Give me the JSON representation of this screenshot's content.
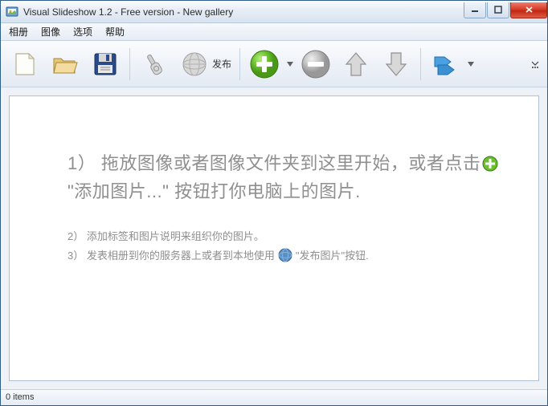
{
  "window": {
    "title": "Visual Slideshow 1.2 - Free version - New gallery"
  },
  "menu": {
    "album": "相册",
    "image": "图像",
    "options": "选项",
    "help": "帮助"
  },
  "toolbar": {
    "publish_label": "发布"
  },
  "content": {
    "step1_a": "1） 拖放图像或者图像文件夹到这里开始，或者点击",
    "step1_b": "\"添加图片...\" 按钮打你电脑上的图片.",
    "step2": "2） 添加标签和图片说明来组织你的图片。",
    "step3_a": "3） 发表相册到你的服务器上或者到本地使用",
    "step3_b": "\"发布图片\"按钮."
  },
  "status": {
    "items": "0 items"
  }
}
